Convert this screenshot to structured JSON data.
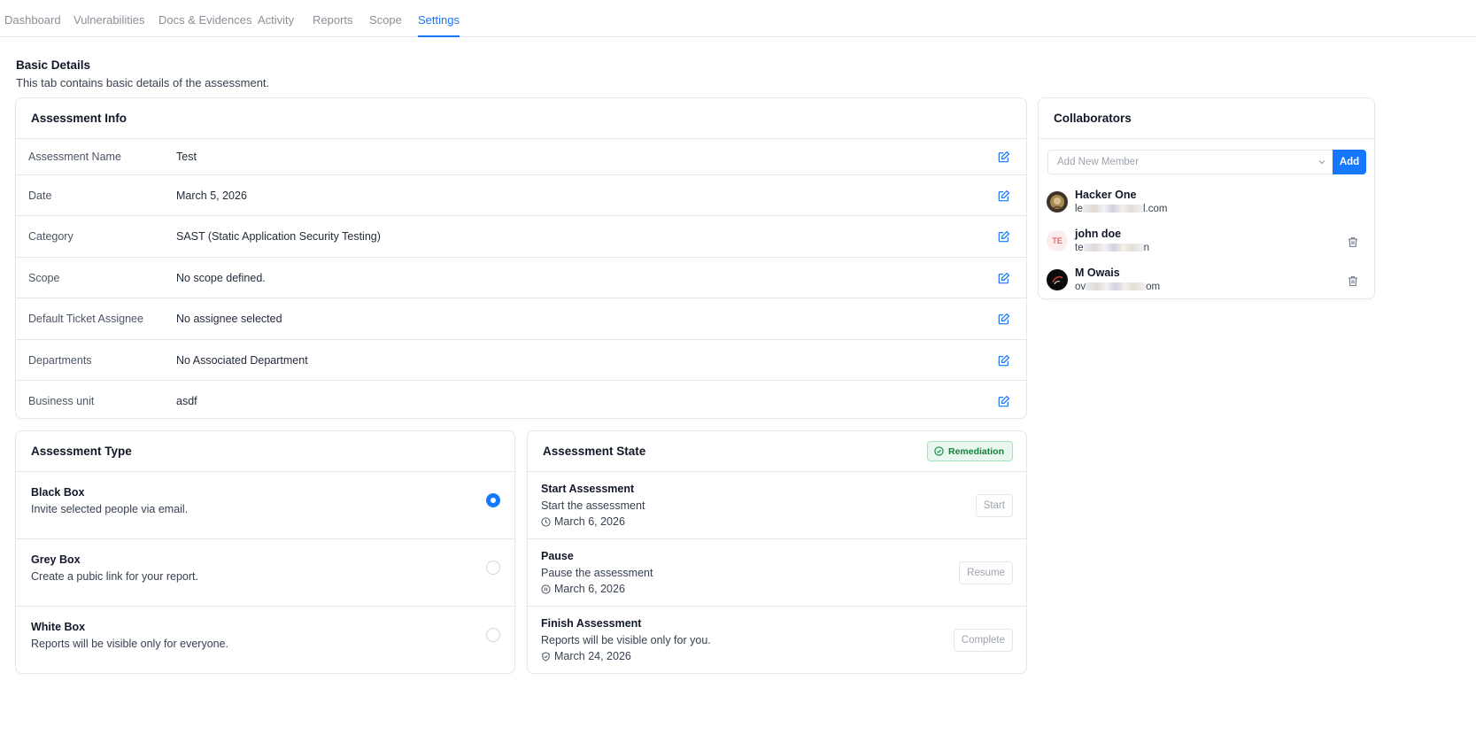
{
  "tabs": [
    "Dashboard",
    "Vulnerabilities",
    "Docs & Evidences",
    "Activity",
    "Reports",
    "Scope",
    "Settings"
  ],
  "active_tab": "Settings",
  "section": {
    "title": "Basic Details",
    "subtitle": "This tab contains basic details of the assessment."
  },
  "assessment_info": {
    "title": "Assessment Info",
    "rows": [
      {
        "label": "Assessment Name",
        "value": "Test"
      },
      {
        "label": "Date",
        "value": "March 5, 2026"
      },
      {
        "label": "Category",
        "value": "SAST (Static Application Security Testing)"
      },
      {
        "label": "Scope",
        "value": "No scope defined."
      },
      {
        "label": "Default Ticket Assignee",
        "value": "No assignee selected"
      },
      {
        "label": "Departments",
        "value": "No Associated Department"
      },
      {
        "label": "Business unit",
        "value": "asdf"
      }
    ]
  },
  "assessment_type": {
    "title": "Assessment Type",
    "options": [
      {
        "title": "Black Box",
        "desc": "Invite selected people via email.",
        "selected": true
      },
      {
        "title": "Grey Box",
        "desc": "Create a pubic link for your report.",
        "selected": false
      },
      {
        "title": "White Box",
        "desc": "Reports will be visible only for everyone.",
        "selected": false
      }
    ]
  },
  "assessment_state": {
    "title": "Assessment State",
    "badge": "Remediation",
    "badge_color": "#16803c",
    "steps": [
      {
        "title": "Start Assessment",
        "desc": "Start the assessment",
        "date": "March 6, 2026",
        "button": "Start"
      },
      {
        "title": "Pause",
        "desc": "Pause the assessment",
        "date": "March 6, 2026",
        "button": "Resume"
      },
      {
        "title": "Finish Assessment",
        "desc": "Reports will be visible only for you.",
        "date": "March 24, 2026",
        "button": "Complete"
      }
    ]
  },
  "collaborators": {
    "title": "Collaborators",
    "placeholder": "Add New Member",
    "add_label": "Add",
    "members": [
      {
        "name": "Hacker One",
        "email_start": "le",
        "email_end": "l.com",
        "avatar": "image",
        "removable": false
      },
      {
        "name": "john doe",
        "email_start": "te",
        "email_end": "n",
        "avatar": "TE",
        "removable": true
      },
      {
        "name": "M Owais",
        "email_start": "ov",
        "email_end": "om",
        "avatar": "image",
        "removable": true
      }
    ]
  },
  "accent_color": "#1677ff"
}
